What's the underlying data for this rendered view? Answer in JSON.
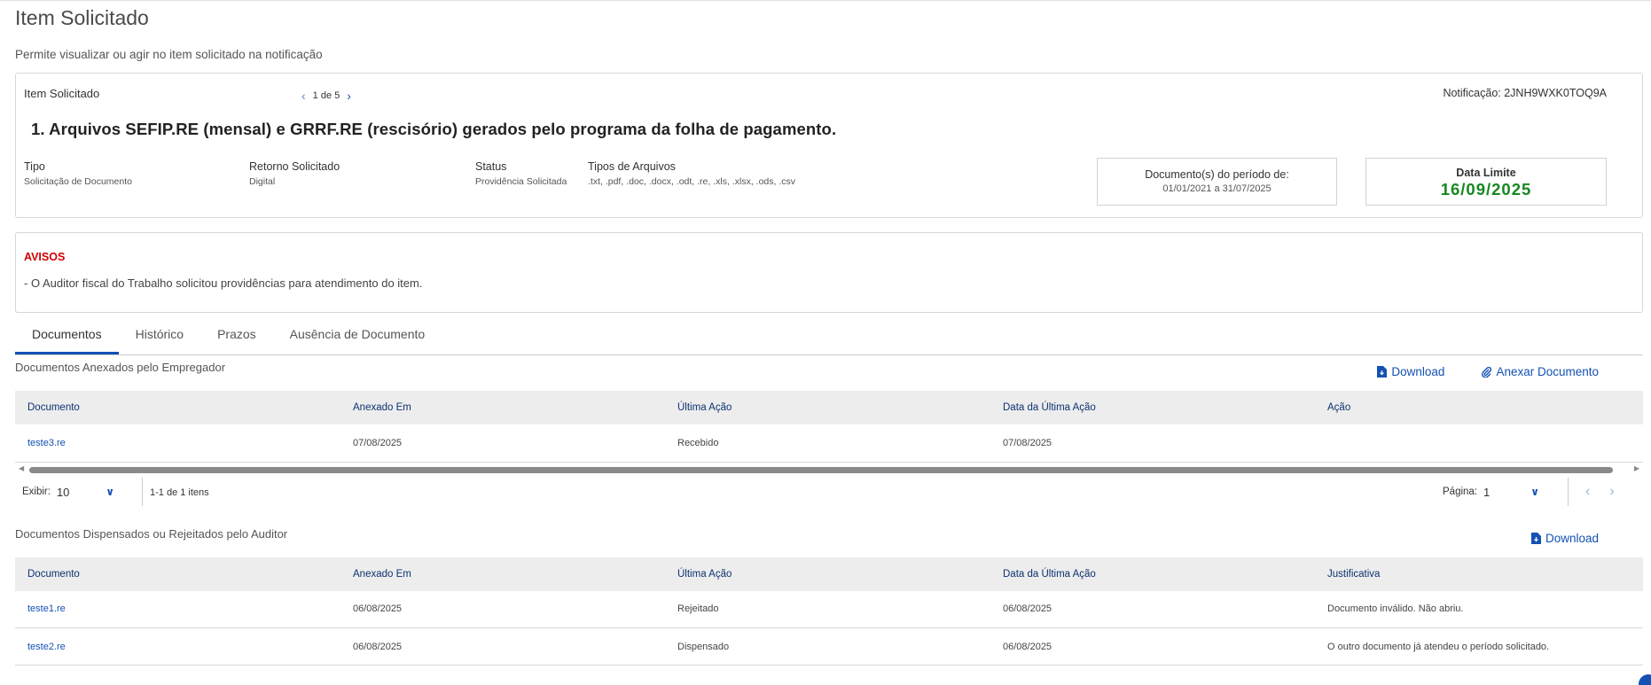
{
  "page": {
    "title": "Item Solicitado",
    "subtitle": "Permite visualizar ou agir no item solicitado na notificação"
  },
  "item": {
    "label": "Item Solicitado",
    "pager": "1 de 5",
    "notification_label": "Notificação: 2JNH9WXK0TOQ9A",
    "title": "1. Arquivos SEFIP.RE (mensal) e GRRF.RE (rescisório) gerados pelo programa da folha de pagamento.",
    "fields": [
      {
        "label": "Tipo",
        "value": "Solicitação de Documento"
      },
      {
        "label": "Retorno Solicitado",
        "value": "Digital"
      },
      {
        "label": "Status",
        "value": "Providência Solicitada"
      },
      {
        "label": "Tipos de Arquivos",
        "value": ".txt, .pdf, .doc, .docx, .odt, .re, .xls, .xlsx, .ods, .csv"
      }
    ],
    "periodo": {
      "label": "Documento(s) do período de:",
      "value": "01/01/2021 a 31/07/2025"
    },
    "data_limite": {
      "label": "Data Limite",
      "value": "16/09/2025",
      "color": "#168821"
    }
  },
  "avisos": {
    "title": "AVISOS",
    "text": "- O Auditor fiscal do Trabalho solicitou providências para atendimento do item."
  },
  "tabs": [
    "Documentos",
    "Histórico",
    "Prazos",
    "Ausência de Documento"
  ],
  "anexados": {
    "title": "Documentos Anexados pelo Empregador",
    "download_label": "Download",
    "anexar_label": "Anexar Documento",
    "columns": [
      "Documento",
      "Anexado Em",
      "Última Ação",
      "Data da Última Ação",
      "Ação"
    ],
    "rows": [
      {
        "documento": "teste3.re",
        "anexado": "07/08/2025",
        "acao": "Recebido",
        "data": "07/08/2025",
        "extra": ""
      }
    ],
    "pagination": {
      "exibir_label": "Exibir:",
      "exibir_value": "10",
      "count": "1-1 de 1 itens",
      "pagina_label": "Página:",
      "pagina_value": "1"
    }
  },
  "dispensados": {
    "title": "Documentos Dispensados ou Rejeitados pelo Auditor",
    "download_label": "Download",
    "columns": [
      "Documento",
      "Anexado Em",
      "Última Ação",
      "Data da Última Ação",
      "Justificativa"
    ],
    "rows": [
      {
        "documento": "teste1.re",
        "anexado": "06/08/2025",
        "acao": "Rejeitado",
        "data": "06/08/2025",
        "extra": "Documento inválido. Não abriu."
      },
      {
        "documento": "teste2.re",
        "anexado": "06/08/2025",
        "acao": "Dispensado",
        "data": "06/08/2025",
        "extra": "O outro documento já atendeu o período solicitado."
      }
    ]
  },
  "colors": {
    "accent": "#1351b4",
    "alert": "#d00000",
    "deadline": "#168821"
  }
}
